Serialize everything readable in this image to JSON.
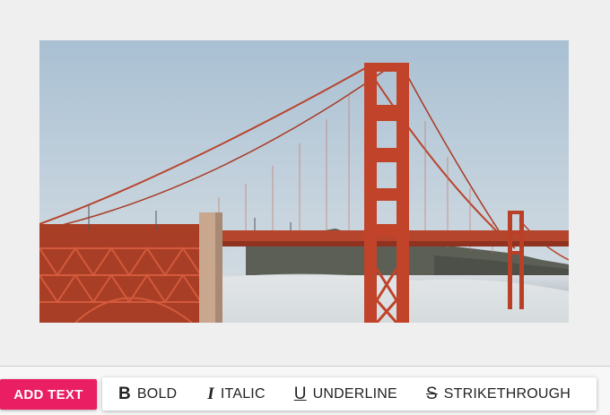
{
  "image": {
    "subject": "golden-gate-bridge-photo"
  },
  "actions": {
    "add_text_label": "ADD TEXT"
  },
  "format_toolbar": {
    "bold": {
      "icon": "B",
      "label": "BOLD"
    },
    "italic": {
      "icon": "I",
      "label": "ITALIC"
    },
    "underline": {
      "icon": "U",
      "label": "UNDERLINE"
    },
    "strikethrough": {
      "icon": "S",
      "label": "STRIKETHROUGH"
    }
  },
  "colors": {
    "accent": "#e91e63",
    "bridge": "#c0432a",
    "sky": "#b9cbd9"
  }
}
